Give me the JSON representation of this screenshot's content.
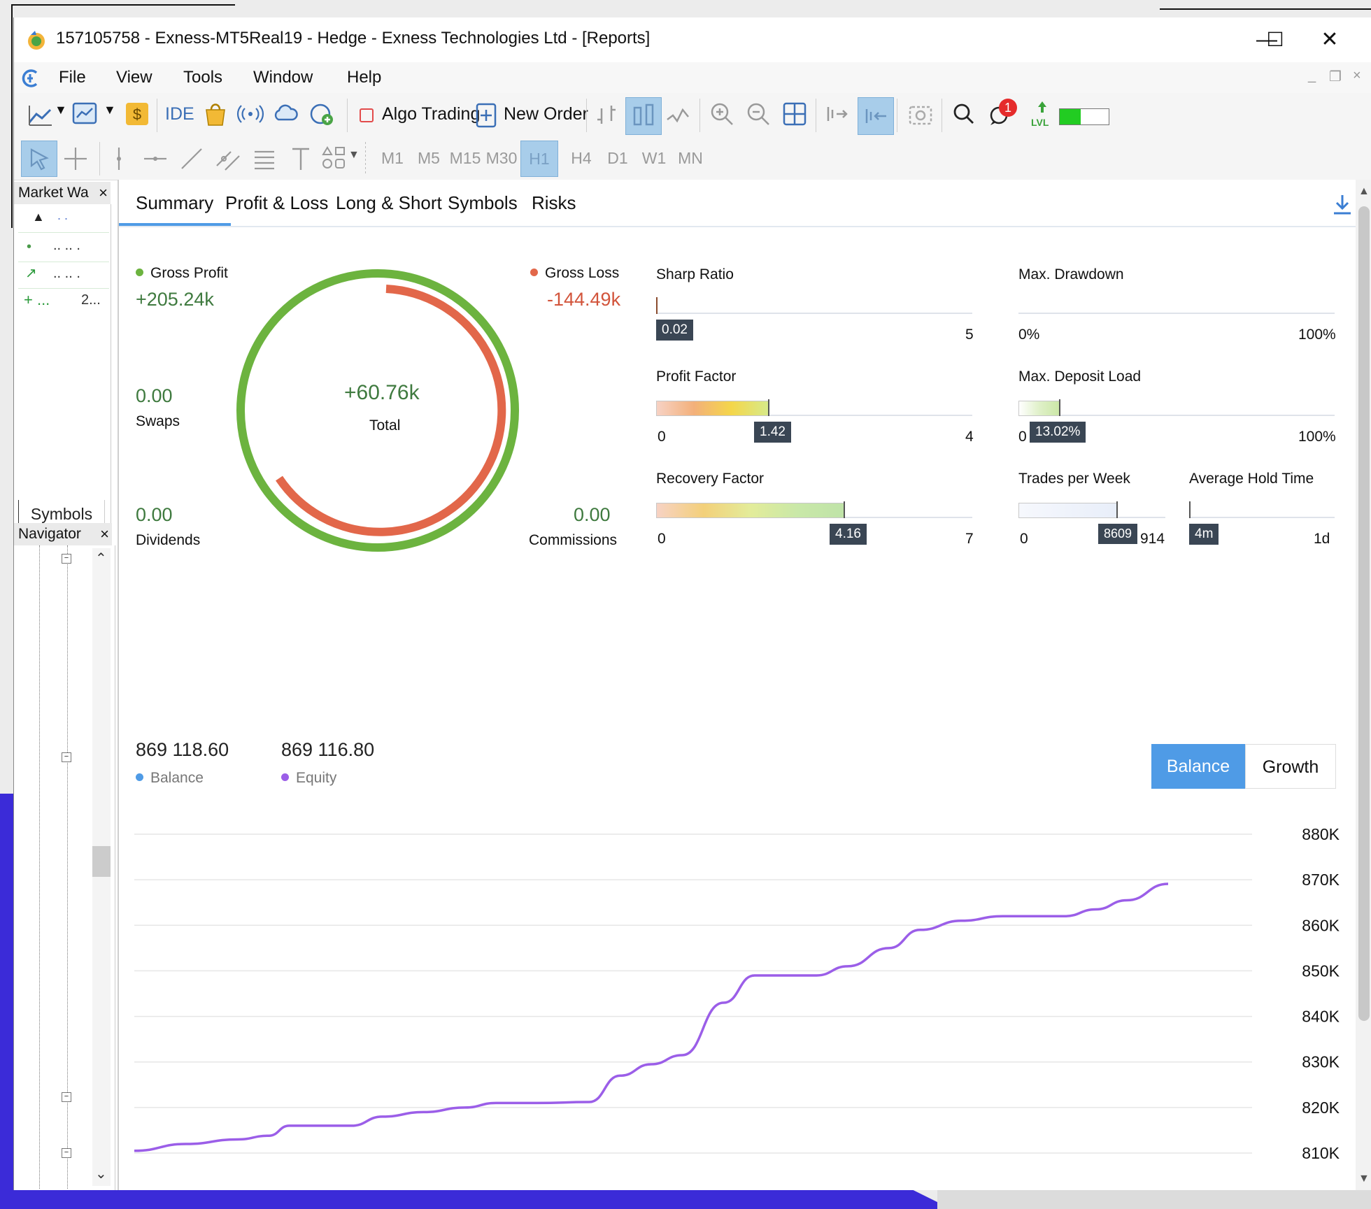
{
  "window": {
    "title": "157105758 - Exness-MT5Real19 - Hedge - Exness Technologies Ltd - [Reports]",
    "minimize": "—",
    "maximize": "☐",
    "close": "✕"
  },
  "menu": {
    "items": [
      "File",
      "View",
      "Tools",
      "Window",
      "Help"
    ]
  },
  "toolbar": {
    "ide": "IDE",
    "algo_trading": "Algo Trading",
    "new_order": "New Order",
    "timeframes": [
      "M1",
      "M5",
      "M15",
      "M30",
      "H1",
      "H4",
      "D1",
      "W1",
      "MN"
    ],
    "active_timeframe": "H1",
    "notification_count": "1",
    "lvl": "LVL"
  },
  "market_watch": {
    "title": "Market Wa",
    "close": "×",
    "rows": [
      {
        "a": "▲",
        "b": ". ."
      },
      {
        "a": "•",
        "b": ".. ..  ."
      },
      {
        "a": "↗",
        "b": ".. ..  ."
      },
      {
        "a": "+ ...",
        "b": "2..."
      }
    ],
    "tab": "Symbols"
  },
  "navigator": {
    "title": "Navigator",
    "close": "×"
  },
  "report": {
    "tabs": [
      "Summary",
      "Profit & Loss",
      "Long & Short",
      "Symbols",
      "Risks"
    ],
    "active_tab": "Summary",
    "gross_profit_label": "Gross Profit",
    "gross_profit": "+205.24k",
    "gross_loss_label": "Gross Loss",
    "gross_loss": "-144.49k",
    "total_value": "+60.76k",
    "total_label": "Total",
    "swaps_value": "0.00",
    "swaps_label": "Swaps",
    "dividends_value": "0.00",
    "dividends_label": "Dividends",
    "commissions_value": "0.00",
    "commissions_label": "Commissions",
    "metrics": {
      "sharp_ratio": {
        "label": "Sharp Ratio",
        "value": "0.02",
        "min": "",
        "max": "5"
      },
      "max_drawdown": {
        "label": "Max. Drawdown",
        "min": "0%",
        "max": "100%"
      },
      "profit_factor": {
        "label": "Profit Factor",
        "value": "1.42",
        "min": "0",
        "max": "4"
      },
      "max_deposit_load": {
        "label": "Max. Deposit Load",
        "value": "13.02%",
        "min": "0",
        "max": "100%"
      },
      "recovery_factor": {
        "label": "Recovery Factor",
        "value": "4.16",
        "min": "0",
        "max": "7"
      },
      "trades_per_week": {
        "label": "Trades per Week",
        "value": "8609",
        "min": "0",
        "max": "914"
      },
      "average_hold_time": {
        "label": "Average Hold Time",
        "value": "4m",
        "max": "1d"
      }
    },
    "balance_value": "869 118.60",
    "balance_label": "Balance",
    "equity_value": "869 116.80",
    "equity_label": "Equity",
    "toggle_balance": "Balance",
    "toggle_growth": "Growth"
  },
  "colors": {
    "profit_green": "#6cb33f",
    "loss_red": "#e2674a",
    "equity_purple": "#9b5ee8",
    "balance_blue": "#4f9be6",
    "accent_toggle": "#4f9be6"
  },
  "chart_data": {
    "type": "line",
    "yticks": [
      "880K",
      "870K",
      "860K",
      "850K",
      "840K",
      "830K",
      "820K",
      "810K"
    ],
    "ylim": [
      805000,
      880000
    ],
    "series": [
      {
        "name": "Equity",
        "color": "#9b5ee8",
        "points": [
          [
            0,
            810500
          ],
          [
            0.05,
            812000
          ],
          [
            0.1,
            813000
          ],
          [
            0.13,
            813800
          ],
          [
            0.15,
            816000
          ],
          [
            0.18,
            816000
          ],
          [
            0.21,
            816000
          ],
          [
            0.24,
            818000
          ],
          [
            0.28,
            819000
          ],
          [
            0.32,
            820000
          ],
          [
            0.35,
            821000
          ],
          [
            0.39,
            821000
          ],
          [
            0.44,
            821200
          ],
          [
            0.47,
            827000
          ],
          [
            0.5,
            829500
          ],
          [
            0.53,
            831500
          ],
          [
            0.57,
            843000
          ],
          [
            0.6,
            849000
          ],
          [
            0.66,
            849000
          ],
          [
            0.69,
            851000
          ],
          [
            0.73,
            855000
          ],
          [
            0.76,
            859000
          ],
          [
            0.8,
            861000
          ],
          [
            0.84,
            862000
          ],
          [
            0.9,
            862000
          ],
          [
            0.93,
            863500
          ],
          [
            0.96,
            865500
          ],
          [
            1.0,
            869100
          ]
        ]
      }
    ]
  }
}
